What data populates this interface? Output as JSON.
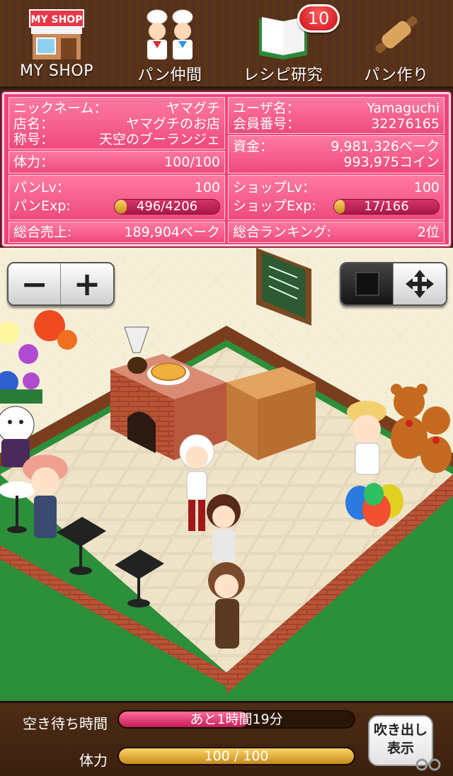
{
  "nav": [
    {
      "label": "MY SHOP",
      "icon": "shop-icon",
      "sign": "MY SHOP"
    },
    {
      "label": "パン仲間",
      "icon": "bakers-icon"
    },
    {
      "label": "レシピ研究",
      "icon": "recipe-book-icon",
      "badge": "10"
    },
    {
      "label": "パン作り",
      "icon": "rolling-pin-icon"
    }
  ],
  "stats": {
    "nickname_label": "ニックネーム：",
    "nickname": "ヤマグチ",
    "shop_label": "店名：",
    "shop": "ヤマグチのお店",
    "title_label": "称号：",
    "title": "天空のブーランジェ",
    "hp_label": "体力：",
    "hp": "100/100",
    "bread_lv_label": "パンLv：",
    "bread_lv": "100",
    "bread_exp_label": "パンExp:",
    "bread_exp": "496/4206",
    "bread_exp_ratio": 0.118,
    "sales_label": "総合売上:",
    "sales": "189,904ベーク",
    "user_label": "ユーザ名：",
    "user": "Yamaguchi",
    "member_label": "会員番号：",
    "member": "32276165",
    "funds_label": "資金：",
    "funds_bake": "9,981,326ベーク",
    "funds_coin": "993,975コイン",
    "shop_lv_label": "ショップLv：",
    "shop_lv": "100",
    "shop_exp_label": "ショップExp:",
    "shop_exp": "17/166",
    "shop_exp_ratio": 0.102,
    "rank_label": "総合ランキング:",
    "rank": "2位"
  },
  "controls": {
    "zoom_out": "−",
    "zoom_in": "+",
    "stop_icon": "stop-icon",
    "move_icon": "move-arrows-icon"
  },
  "bottom": {
    "wait_label": "空き待ち時間",
    "wait_text": "あと1時間19分",
    "wait_ratio": 0.55,
    "hp_label": "体力",
    "hp_text": "100 / 100",
    "hp_ratio": 1.0,
    "bubble_line1": "吹き出し",
    "bubble_line2": "表示"
  },
  "colors": {
    "panel_pink": "#f0437a",
    "nav_brown": "#5a3419",
    "wait_fill": "#e2457b",
    "hp_fill": "#e0a030"
  }
}
